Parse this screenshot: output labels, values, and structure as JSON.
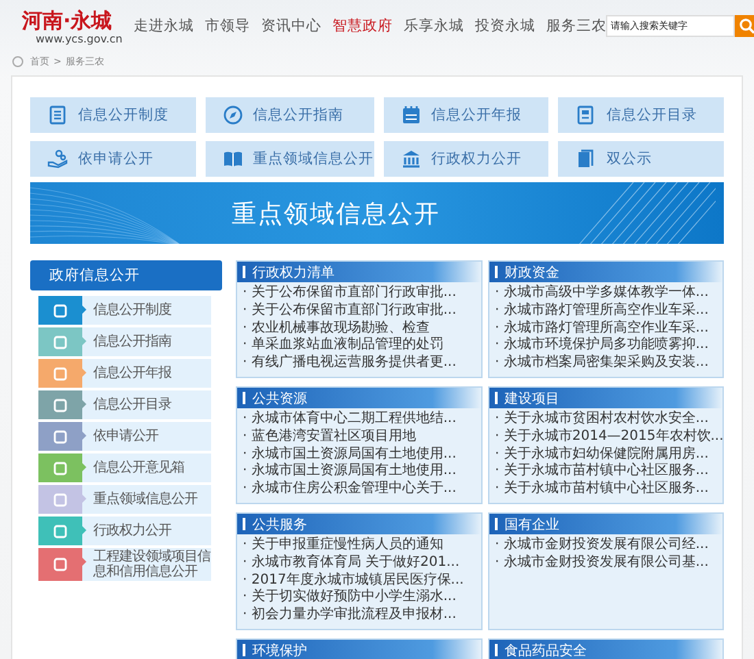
{
  "logo": {
    "title": "河南·永城",
    "url": "www.ycs.gov.cn"
  },
  "nav": [
    {
      "label": "走进永城",
      "selected": false
    },
    {
      "label": "市领导",
      "selected": false
    },
    {
      "label": "资讯中心",
      "selected": false
    },
    {
      "label": "智慧政府",
      "selected": true
    },
    {
      "label": "乐享永城",
      "selected": false
    },
    {
      "label": "投资永城",
      "selected": false
    },
    {
      "label": "服务三农",
      "selected": false
    }
  ],
  "search": {
    "placeholder": "请输入搜索关键字"
  },
  "breadcrumb": [
    "首页",
    ">",
    "服务三农"
  ],
  "quick_links": [
    "信息公开制度",
    "信息公开指南",
    "信息公开年报",
    "信息公开目录",
    "依申请公开",
    "重点领域信息公开",
    "行政权力公开",
    "双公示"
  ],
  "banner": {
    "title": "重点领域信息公开"
  },
  "sidebar": {
    "title": "政府信息公开",
    "items": [
      {
        "label": "信息公开制度",
        "color": "#1b8fd0"
      },
      {
        "label": "信息公开指南",
        "color": "#7cc6c4"
      },
      {
        "label": "信息公开年报",
        "color": "#f5a96b"
      },
      {
        "label": "信息公开目录",
        "color": "#7ea4a8"
      },
      {
        "label": "依申请公开",
        "color": "#8ea0c6"
      },
      {
        "label": "信息公开意见箱",
        "color": "#7cc160"
      },
      {
        "label": "重点领域信息公开",
        "color": "#c3c3e4"
      },
      {
        "label": "行政权力公开",
        "color": "#3fc0b8"
      },
      {
        "label": "工程建设领域项目信息和信用信息公开",
        "color": "#e46f72"
      }
    ]
  },
  "panels": [
    {
      "title": "行政权力清单",
      "items": [
        "· 关于公布保留市直部门行政审批...",
        "· 关于公布保留市直部门行政审批...",
        "· 农业机械事故现场勘验、检查",
        "· 单采血浆站血液制品管理的处罚",
        "· 有线广播电视运营服务提供者更..."
      ]
    },
    {
      "title": "财政资金",
      "items": [
        "· 永城市高级中学多媒体教学一体...",
        "· 永城市路灯管理所高空作业车采...",
        "· 永城市路灯管理所高空作业车采...",
        "· 永城市环境保护局多功能喷雾抑...",
        "· 永城市档案局密集架采购及安装..."
      ]
    },
    {
      "title": "公共资源",
      "items": [
        "· 永城市体育中心二期工程供地结...",
        "· 蓝色港湾安置社区项目用地",
        "· 永城市国土资源局国有土地使用...",
        "· 永城市国土资源局国有土地使用...",
        "· 永城市住房公积金管理中心关于..."
      ]
    },
    {
      "title": "建设项目",
      "items": [
        "· 关于永城市贫困村农村饮水安全...",
        "· 关于永城市2014—2015年农村饮...",
        "· 关于永城市妇幼保健院附属用房...",
        "· 关于永城市苗村镇中心社区服务...",
        "· 关于永城市苗村镇中心社区服务..."
      ]
    },
    {
      "title": "公共服务",
      "items": [
        "· 关于申报重症慢性病人员的通知",
        "· 永城市教育体育局 关于做好201...",
        "· 2017年度永城市城镇居民医疗保...",
        "· 关于切实做好预防中小学生溺水...",
        "· 初会力量办学审批流程及申报材..."
      ]
    },
    {
      "title": "国有企业",
      "items": [
        "· 永城市金财投资发展有限公司经...",
        "· 永城市金财投资发展有限公司基..."
      ]
    },
    {
      "title": "环境保护"
    },
    {
      "title": "食品药品安全"
    }
  ]
}
